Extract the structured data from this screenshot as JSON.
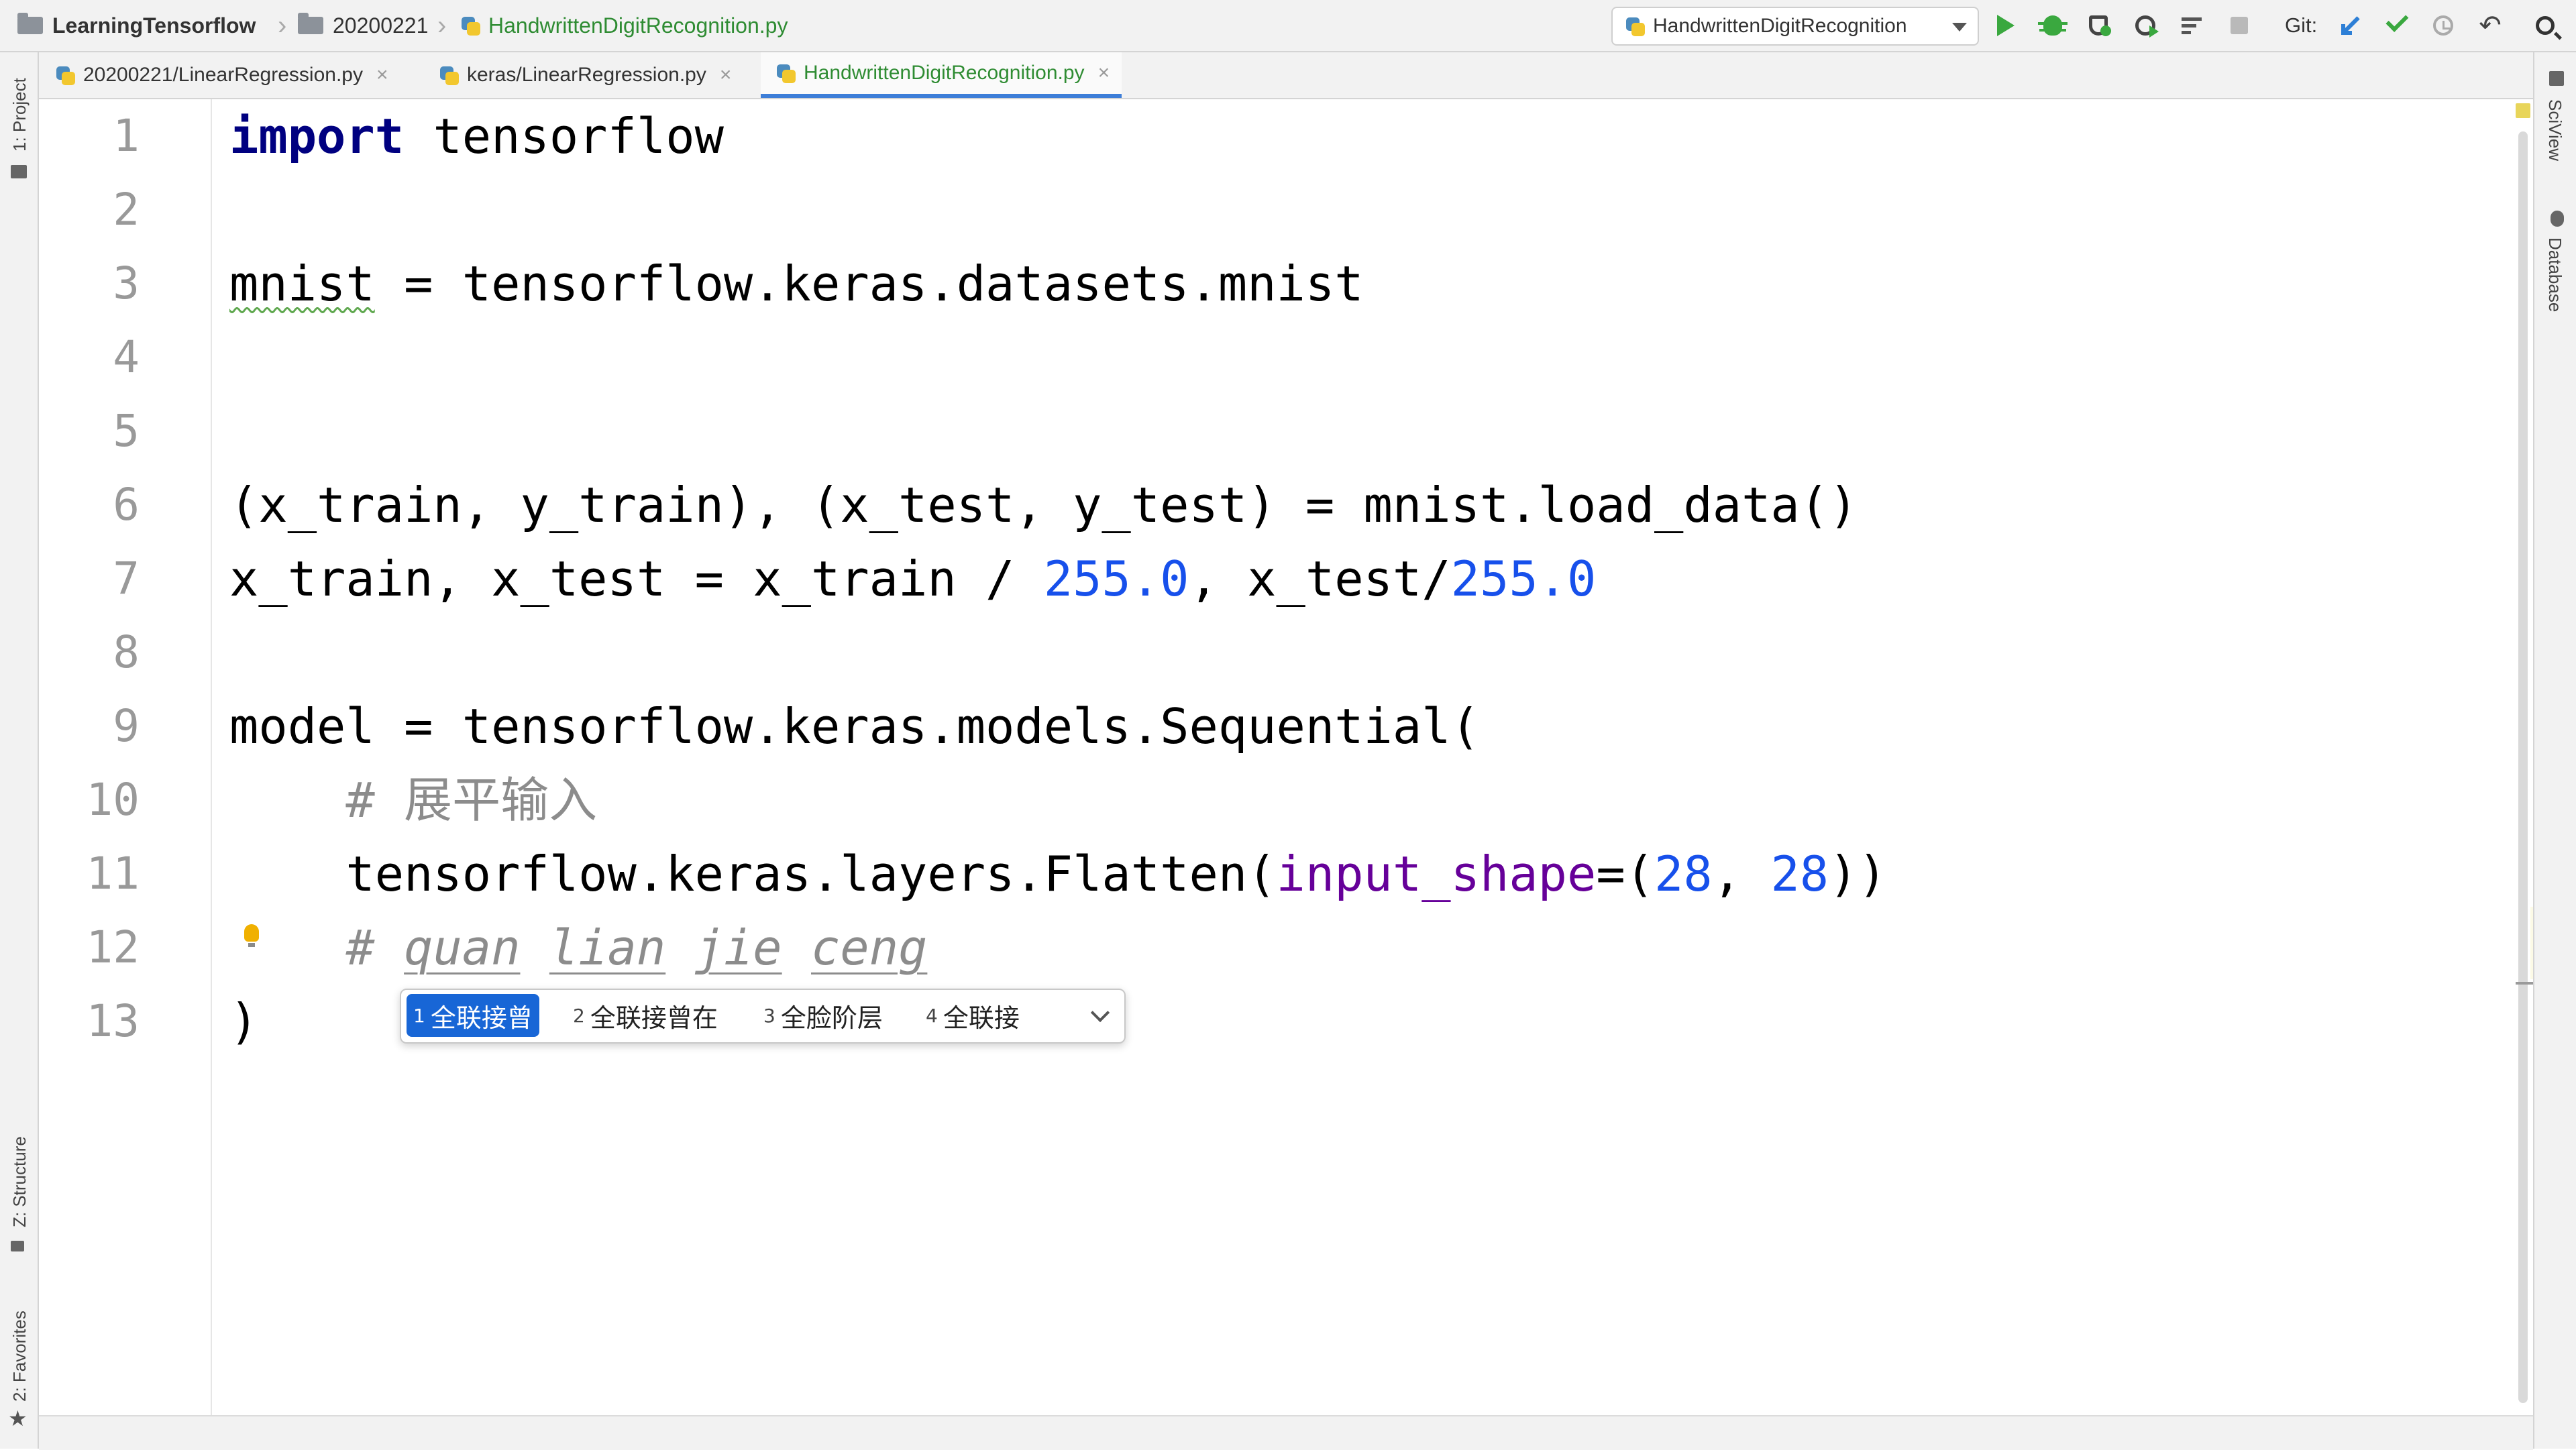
{
  "breadcrumb": {
    "project": "LearningTensorflow",
    "folder": "20200221",
    "file": "HandwrittenDigitRecognition.py"
  },
  "toolbar": {
    "run_config": "HandwrittenDigitRecognition",
    "git_label": "Git:"
  },
  "tabs": [
    {
      "label": "20200221/LinearRegression.py",
      "close": "×"
    },
    {
      "label": "keras/LinearRegression.py",
      "close": "×"
    },
    {
      "label": "HandwrittenDigitRecognition.py",
      "close": "×",
      "active": true
    }
  ],
  "side": {
    "project": "1: Project",
    "structure": "Z: Structure",
    "favorites": "2: Favorites",
    "sciview": "SciView",
    "database": "Database"
  },
  "editor": {
    "line_numbers": [
      "1",
      "2",
      "3",
      "4",
      "5",
      "6",
      "7",
      "8",
      "9",
      "10",
      "11",
      "12",
      "13"
    ],
    "current_line": 12,
    "code": {
      "l1_kw": "import",
      "l1_rest": " tensorflow",
      "l3_var": "mnist",
      "l3_rest": " = tensorflow.keras.datasets.mnist",
      "l6": "(x_train, y_train), (x_test, y_test) = mnist.load_data()",
      "l7_a": "x_train, x_test = x_train / ",
      "l7_n1": "255.0",
      "l7_b": ", x_test/",
      "l7_n2": "255.0",
      "l9": "model = tensorflow.keras.models.Sequential(",
      "l10": "    # 展平输入",
      "l11_a": "    tensorflow.keras.layers.Flatten(",
      "l11_p": "input_shape",
      "l11_b": "=(",
      "l11_n1": "28",
      "l11_c": ", ",
      "l11_n2": "28",
      "l11_d": "))",
      "l12_hash": "    # ",
      "l12_w1": "quan",
      "l12_w2": "lian",
      "l12_w3": "jie",
      "l12_w4": "ceng",
      "l13": ")"
    }
  },
  "ime": {
    "candidates": [
      {
        "n": "1",
        "text": "全联接曾"
      },
      {
        "n": "2",
        "text": "全联接曾在"
      },
      {
        "n": "3",
        "text": "全脸阶层"
      },
      {
        "n": "4",
        "text": "全联接"
      }
    ],
    "selected": 0
  },
  "colors": {
    "keyword": "#000080",
    "number": "#1750eb",
    "parameter": "#660099",
    "comment": "#8c8c8c",
    "current_line": "#fcfae6",
    "ime_selected": "#1866d6",
    "file_green": "#2f8c33"
  }
}
